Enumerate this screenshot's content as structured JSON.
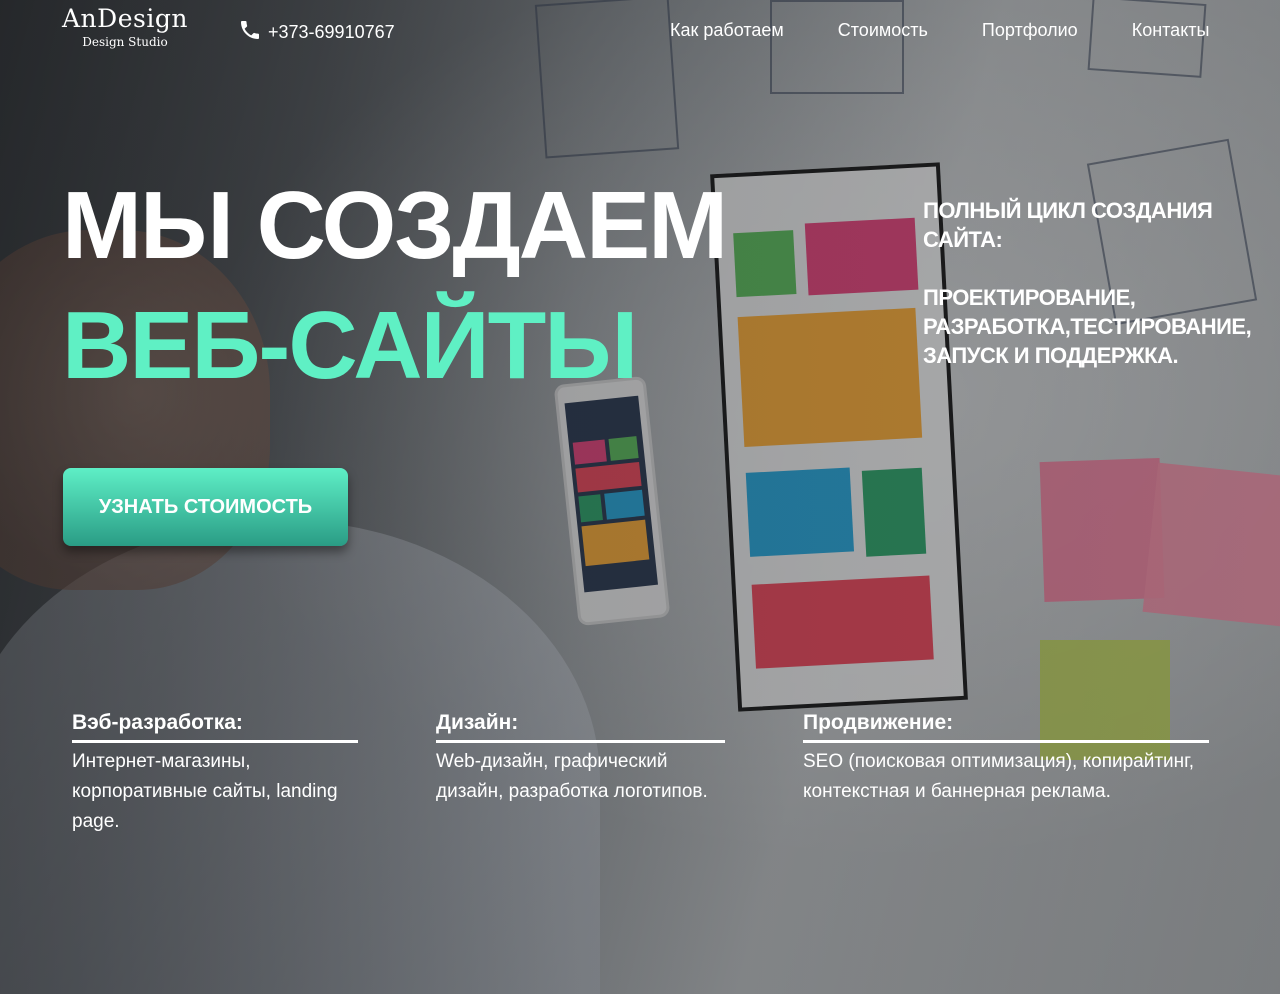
{
  "header": {
    "logo_name": "AnDesign",
    "logo_sub": "Design Studio",
    "phone": "+373-69910767",
    "phone_icon": "phone-icon",
    "nav": [
      {
        "label": "Как работаем"
      },
      {
        "label": "Стоимость"
      },
      {
        "label": "Портфолио"
      },
      {
        "label": "Контакты"
      }
    ]
  },
  "hero": {
    "title_line1": "МЫ СОЗДАЕМ",
    "title_line2": "ВЕБ-САЙТЫ",
    "accent_color": "#5ff0c4",
    "aside_line1": "ПОЛНЫЙ ЦИКЛ СОЗДАНИЯ САЙТА:",
    "aside_line2": "ПРОЕКТИРОВАНИЕ, РАЗРАБОТКА,ТЕСТИРОВАНИЕ, ЗАПУСК И ПОДДЕРЖКА.",
    "cta_label": "УЗНАТЬ СТОИМОСТЬ"
  },
  "services": [
    {
      "title": "Вэб-разработка:",
      "desc": "Интернет-магазины, корпоративные сайты, landing page."
    },
    {
      "title": "Дизайн:",
      "desc": "Web-дизайн, графический дизайн, разработка логотипов."
    },
    {
      "title": "Продвижение:",
      "desc": "SEO (поисковая оптимизация), копирайтинг, контекстная и баннерная реклама."
    }
  ]
}
